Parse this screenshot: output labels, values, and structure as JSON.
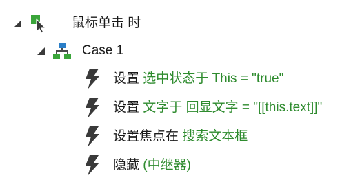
{
  "event": {
    "label": "鼠标单击 时"
  },
  "case": {
    "label": "Case 1"
  },
  "actions": [
    {
      "verb": "设置",
      "target": " 选中状态于 This = \"true\""
    },
    {
      "verb": "设置",
      "target": " 文字于 回显文字 = \"[[this.text]]\""
    },
    {
      "verb": "设置焦点在",
      "target": " 搜索文本框"
    },
    {
      "verb": "隐藏",
      "target": " (中继器)"
    }
  ],
  "colors": {
    "event_icon_green": "#3aa53a",
    "case_icon_blue": "#2b7fc8",
    "case_icon_green": "#3aa53a",
    "action_icon": "#3a3a3a",
    "target_text": "#2e8b2e"
  },
  "icons": {
    "expand": "expanded-triangle-icon",
    "event": "cursor-event-icon",
    "case": "case-tree-icon",
    "action": "lightning-icon"
  }
}
